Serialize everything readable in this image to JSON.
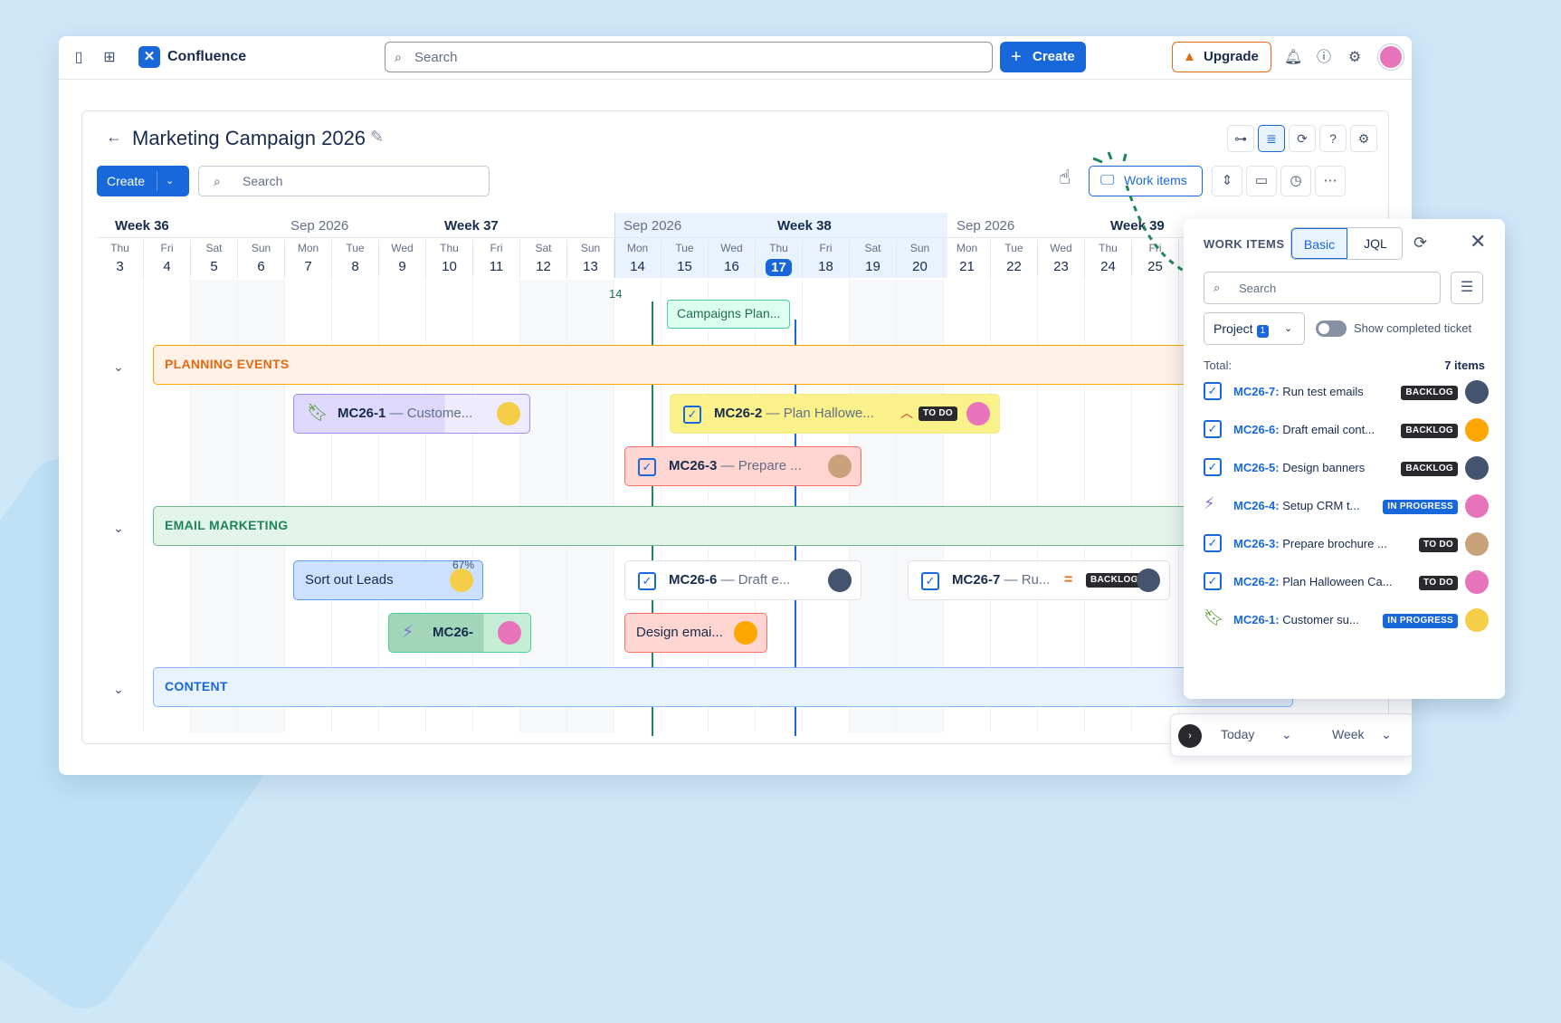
{
  "topbar": {
    "brand": "Confluence",
    "search_placeholder": "Search",
    "create": "Create",
    "upgrade": "Upgrade"
  },
  "page": {
    "title": "Marketing Campaign 2026",
    "create": "Create",
    "search_placeholder": "Search",
    "work_items": "Work items"
  },
  "timeline": {
    "weeks": [
      {
        "label": "Week 36"
      },
      {
        "month": "Sep 2026",
        "label": "Week 37"
      },
      {
        "month": "Sep 2026",
        "label": "Week 38"
      },
      {
        "month": "Sep 2026",
        "label": "Week 39"
      }
    ],
    "days": [
      {
        "n": "Thu",
        "d": "3"
      },
      {
        "n": "Fri",
        "d": "4"
      },
      {
        "n": "Sat",
        "d": "5"
      },
      {
        "n": "Sun",
        "d": "6"
      },
      {
        "n": "Mon",
        "d": "7"
      },
      {
        "n": "Tue",
        "d": "8"
      },
      {
        "n": "Wed",
        "d": "9"
      },
      {
        "n": "Thu",
        "d": "10"
      },
      {
        "n": "Fri",
        "d": "11"
      },
      {
        "n": "Sat",
        "d": "12"
      },
      {
        "n": "Sun",
        "d": "13"
      },
      {
        "n": "Mon",
        "d": "14"
      },
      {
        "n": "Tue",
        "d": "15"
      },
      {
        "n": "Wed",
        "d": "16"
      },
      {
        "n": "Thu",
        "d": "17"
      },
      {
        "n": "Fri",
        "d": "18"
      },
      {
        "n": "Sat",
        "d": "19"
      },
      {
        "n": "Sun",
        "d": "20"
      },
      {
        "n": "Mon",
        "d": "21"
      },
      {
        "n": "Tue",
        "d": "22"
      },
      {
        "n": "Wed",
        "d": "23"
      },
      {
        "n": "Thu",
        "d": "24"
      },
      {
        "n": "Fri",
        "d": "25"
      }
    ],
    "today_index": 14,
    "milestone_marker": "14",
    "milestone": "Campaigns Plan...",
    "groups": [
      "PLANNING EVENTS",
      "EMAIL MARKETING",
      "CONTENT"
    ],
    "bars": {
      "mc1": {
        "key": "MC26-1",
        "sum": "— Custome..."
      },
      "mc2": {
        "key": "MC26-2",
        "sum": "— Plan Hallowe...",
        "status": "TO DO"
      },
      "mc3": {
        "key": "MC26-3",
        "sum": "— Prepare ..."
      },
      "leads": {
        "text": "Sort out Leads"
      },
      "mc4": {
        "key": "MC26-",
        "progress": "67%"
      },
      "mc6": {
        "key": "MC26-6",
        "sum": "— Draft e..."
      },
      "mc7": {
        "key": "MC26-7",
        "sum": "— Ru...",
        "status": "BACKLOG"
      },
      "design": {
        "text": "Design emai..."
      }
    },
    "nav": {
      "today": "Today",
      "scale": "Week"
    }
  },
  "side_panel": {
    "title": "WORK ITEMS",
    "tabs": [
      "Basic",
      "JQL"
    ],
    "search_placeholder": "Search",
    "project_label": "Project",
    "project_count": "1",
    "toggle_label": "Show completed ticket",
    "total_label": "Total:",
    "total_value": "7 items",
    "items": [
      {
        "key": "MC26-7:",
        "title": " Run test emails",
        "status": "BACKLOG"
      },
      {
        "key": "MC26-6:",
        "title": " Draft email cont...",
        "status": "BACKLOG"
      },
      {
        "key": "MC26-5:",
        "title": " Design banners",
        "status": "BACKLOG"
      },
      {
        "key": "MC26-4:",
        "title": " Setup CRM t...",
        "status": "IN PROGRESS"
      },
      {
        "key": "MC26-3:",
        "title": " Prepare brochure ...",
        "status": "TO DO"
      },
      {
        "key": "MC26-2:",
        "title": " Plan Halloween Ca...",
        "status": "TO DO"
      },
      {
        "key": "MC26-1:",
        "title": " Customer su...",
        "status": "IN PROGRESS"
      }
    ]
  }
}
